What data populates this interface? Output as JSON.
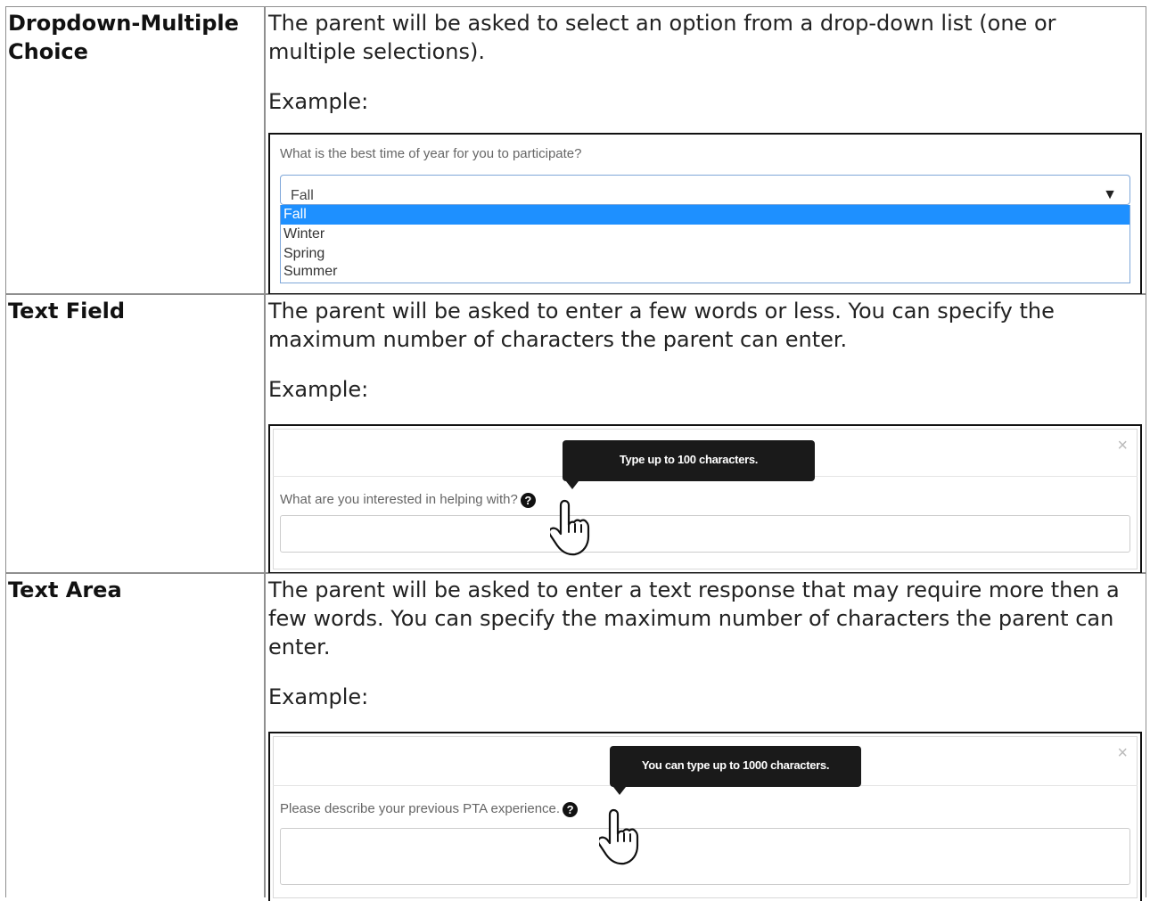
{
  "rows": [
    {
      "term_line1": "Dropdown-Multiple",
      "term_line2": "Choice",
      "description": "The parent will be asked to select an option from a drop-down list (one or multiple selections).",
      "example_label": "Example:",
      "example": {
        "question": "What is the best time of year for you to participate?",
        "selected_value": "Fall",
        "options": [
          "Fall",
          "Winter",
          "Spring",
          "Summer"
        ],
        "highlighted_option": "Fall"
      }
    },
    {
      "term": "Text Field",
      "description": "The parent will be asked to enter a few words or less. You can specify the maximum number of characters the parent can enter.",
      "example_label": "Example:",
      "example": {
        "tooltip": "Type up to 100 characters.",
        "question": "What are you interested in helping with?",
        "help_glyph": "?",
        "close_glyph": "×"
      }
    },
    {
      "term": "Text Area",
      "description": "The parent will be asked to enter a text response that may require more then a few words. You can specify the maximum number of characters the parent can enter.",
      "example_label": "Example:",
      "example": {
        "tooltip": "You can type up to 1000 characters.",
        "question": "Please describe your previous PTA experience.",
        "help_glyph": "?",
        "close_glyph": "×"
      }
    }
  ],
  "icons": {
    "dropdown_arrow": "▼",
    "cursor": "hand-pointer-icon"
  }
}
